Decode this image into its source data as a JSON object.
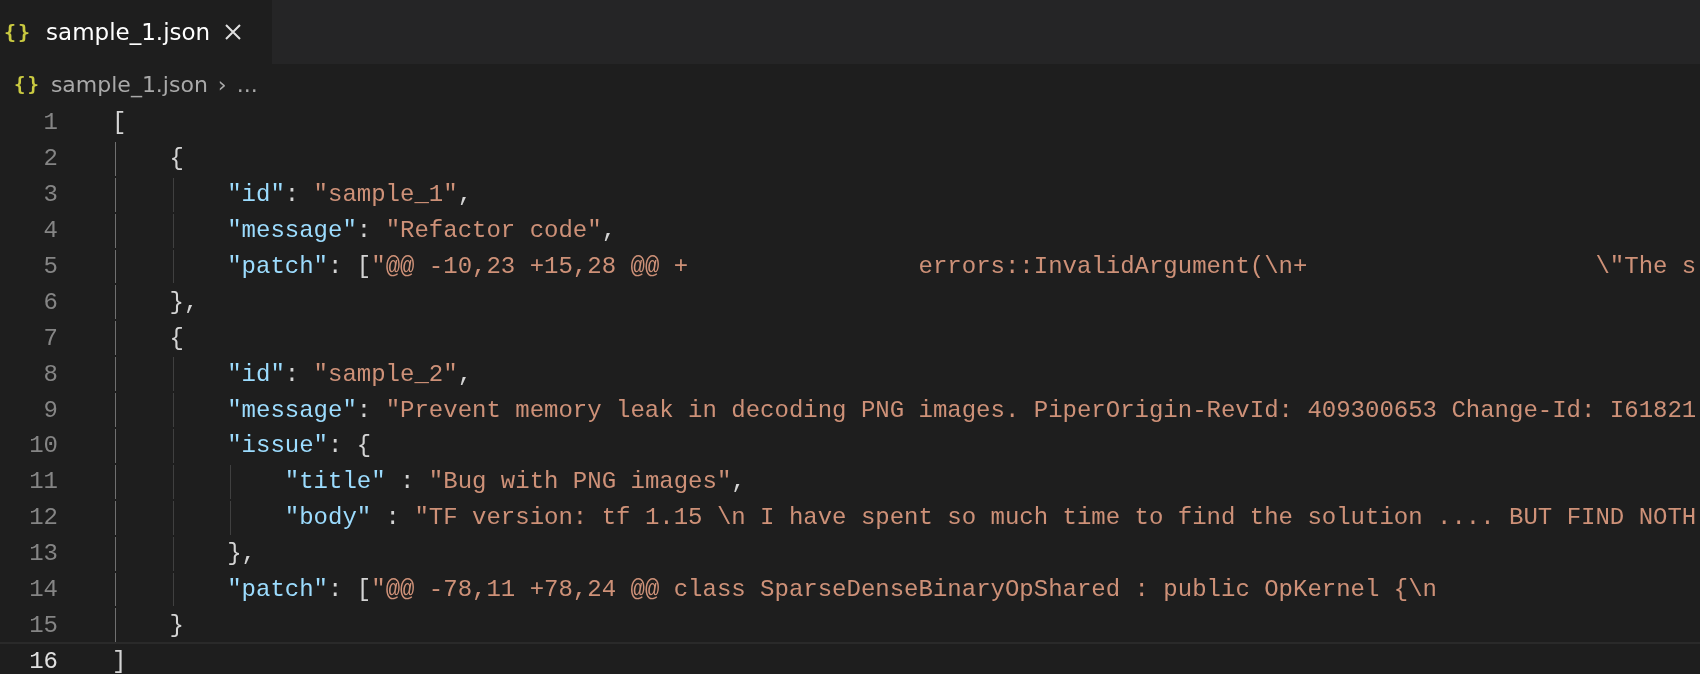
{
  "tabs": [
    {
      "icon_glyph": "{}",
      "label": "sample_1.json",
      "selected": true
    }
  ],
  "breadcrumb": {
    "icon_glyph": "{}",
    "file": "sample_1.json",
    "separator": "›",
    "rest": "..."
  },
  "editor": {
    "lines": [
      {
        "number": "1",
        "current": false,
        "tokens": [
          {
            "kind": "punct",
            "text": "["
          }
        ]
      },
      {
        "number": "2",
        "current": false,
        "tokens": [
          {
            "kind": "punct",
            "text": "    {"
          }
        ]
      },
      {
        "number": "3",
        "current": false,
        "tokens": [
          {
            "kind": "key",
            "text": "        \"id\""
          },
          {
            "kind": "punct",
            "text": ": "
          },
          {
            "kind": "string",
            "text": "\"sample_1\""
          },
          {
            "kind": "punct",
            "text": ","
          }
        ]
      },
      {
        "number": "4",
        "current": false,
        "tokens": [
          {
            "kind": "key",
            "text": "        \"message\""
          },
          {
            "kind": "punct",
            "text": ": "
          },
          {
            "kind": "string",
            "text": "\"Refactor code\""
          },
          {
            "kind": "punct",
            "text": ","
          }
        ]
      },
      {
        "number": "5",
        "current": false,
        "tokens": [
          {
            "kind": "key",
            "text": "        \"patch\""
          },
          {
            "kind": "punct",
            "text": ": ["
          },
          {
            "kind": "string",
            "text": "\"@@ -10,23 +15,28 @@ +                errors::InvalidArgument(\\n+                    \\\"The s"
          }
        ]
      },
      {
        "number": "6",
        "current": false,
        "tokens": [
          {
            "kind": "punct",
            "text": "    },"
          }
        ]
      },
      {
        "number": "7",
        "current": false,
        "tokens": [
          {
            "kind": "punct",
            "text": "    {"
          }
        ]
      },
      {
        "number": "8",
        "current": false,
        "tokens": [
          {
            "kind": "key",
            "text": "        \"id\""
          },
          {
            "kind": "punct",
            "text": ": "
          },
          {
            "kind": "string",
            "text": "\"sample_2\""
          },
          {
            "kind": "punct",
            "text": ","
          }
        ]
      },
      {
        "number": "9",
        "current": false,
        "tokens": [
          {
            "kind": "key",
            "text": "        \"message\""
          },
          {
            "kind": "punct",
            "text": ": "
          },
          {
            "kind": "string",
            "text": "\"Prevent memory leak in decoding PNG images. PiperOrigin-RevId: 409300653 Change-Id: I61821"
          }
        ]
      },
      {
        "number": "10",
        "current": false,
        "tokens": [
          {
            "kind": "key",
            "text": "        \"issue\""
          },
          {
            "kind": "punct",
            "text": ": {"
          }
        ]
      },
      {
        "number": "11",
        "current": false,
        "tokens": [
          {
            "kind": "key",
            "text": "            \"title\""
          },
          {
            "kind": "punct",
            "text": " : "
          },
          {
            "kind": "string",
            "text": "\"Bug with PNG images\""
          },
          {
            "kind": "punct",
            "text": ","
          }
        ]
      },
      {
        "number": "12",
        "current": false,
        "tokens": [
          {
            "kind": "key",
            "text": "            \"body\""
          },
          {
            "kind": "punct",
            "text": " : "
          },
          {
            "kind": "string",
            "text": "\"TF version: tf 1.15 \\n I have spent so much time to find the solution .... BUT FIND NOTH"
          }
        ]
      },
      {
        "number": "13",
        "current": false,
        "tokens": [
          {
            "kind": "punct",
            "text": "        },"
          }
        ]
      },
      {
        "number": "14",
        "current": false,
        "tokens": [
          {
            "kind": "key",
            "text": "        \"patch\""
          },
          {
            "kind": "punct",
            "text": ": ["
          },
          {
            "kind": "string",
            "text": "\"@@ -78,11 +78,24 @@ class SparseDenseBinaryOpShared : public OpKernel {\\n"
          }
        ]
      },
      {
        "number": "15",
        "current": false,
        "tokens": [
          {
            "kind": "punct",
            "text": "    }"
          }
        ]
      },
      {
        "number": "16",
        "current": true,
        "tokens": [
          {
            "kind": "punct",
            "text": "]"
          }
        ]
      }
    ]
  }
}
